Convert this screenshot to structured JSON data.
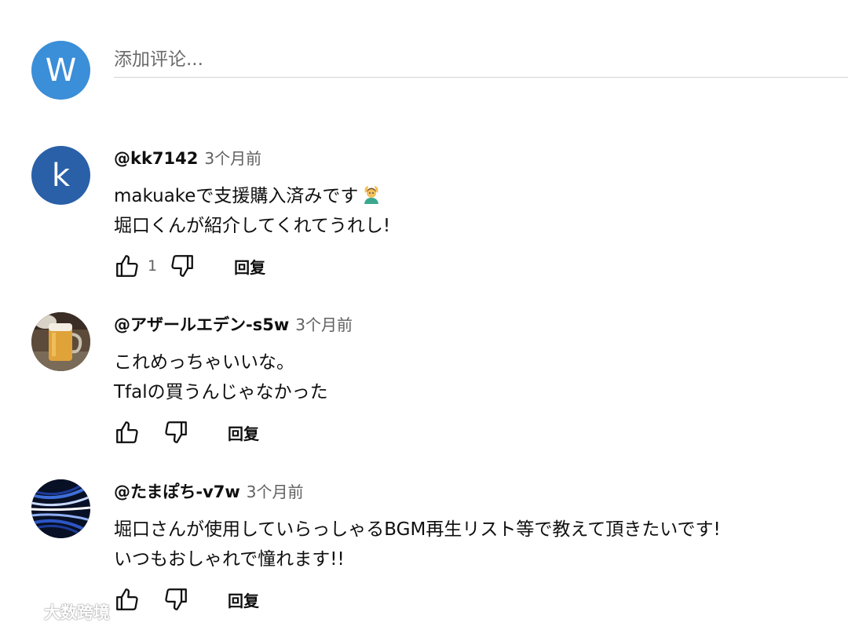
{
  "composer": {
    "avatar_letter": "W",
    "placeholder": "添加评论..."
  },
  "comments": [
    {
      "author": "@kk7142",
      "time": "3个月前",
      "lines": [
        "makuakeで支援購入済みです",
        "堀口くんが紹介してくれてうれし!"
      ],
      "avatar_letter": "k",
      "emoji": "person-gesturing-ok-emoji",
      "likes": "1",
      "reply_label": "回复"
    },
    {
      "author": "@アザールエデン-s5w",
      "time": "3个月前",
      "lines": [
        "これめっちゃいいな。",
        "Tfalの買うんじゃなかった"
      ],
      "avatar_image": "beer-mug-photo",
      "likes": "",
      "reply_label": "回复"
    },
    {
      "author": "@たまぽち-v7w",
      "time": "3个月前",
      "lines": [
        "堀口さんが使用していらっしゃるBGM再生リスト等で教えて頂きたいです!",
        "いつもおしゃれで憧れます!!"
      ],
      "avatar_image": "blue-light-streaks-photo",
      "likes": "",
      "reply_label": "回复"
    }
  ],
  "icons": {
    "like": "thumbs-up-icon",
    "dislike": "thumbs-down-icon"
  },
  "colors": {
    "composer_avatar": "#3b8ed8",
    "letter_avatar": "#2960a8",
    "secondary_text": "#606060"
  },
  "watermark": {
    "text": "大数跨境"
  }
}
